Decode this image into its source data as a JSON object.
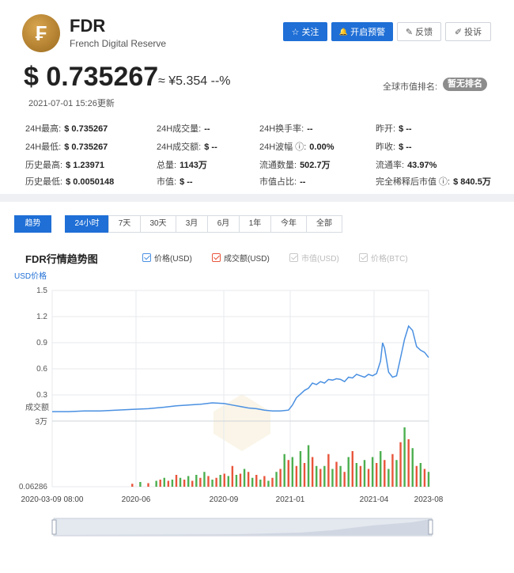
{
  "header": {
    "symbol": "FDR",
    "full_name": "French Digital Reserve",
    "logo_glyph": "₣",
    "buttons": [
      {
        "icon": "star-icon",
        "glyph": "☆",
        "label": "关注"
      },
      {
        "icon": "bell-icon",
        "glyph": "🔔",
        "label": "开启预警"
      },
      {
        "icon": "edit-icon",
        "glyph": "✎",
        "label": "反馈"
      },
      {
        "icon": "pen-icon",
        "glyph": "✐",
        "label": "投诉"
      }
    ]
  },
  "price": {
    "usd": "$ 0.735267",
    "cny": "≈ ¥5.354  --%",
    "updated": "2021-07-01 15:26更新",
    "rank_label": "全球市值排名:",
    "rank_value": "暂无排名"
  },
  "stats": [
    [
      {
        "k": "24H最高:",
        "v": "$ 0.735267"
      },
      {
        "k": "24H成交量:",
        "v": "--"
      },
      {
        "k": "24H换手率:",
        "v": "--"
      },
      {
        "k": "昨开:",
        "v": "$ --"
      }
    ],
    [
      {
        "k": "24H最低:",
        "v": "$ 0.735267"
      },
      {
        "k": "24H成交额:",
        "v": "$ --"
      },
      {
        "k": "24H波幅 ⓘ:",
        "v": "0.00%"
      },
      {
        "k": "昨收:",
        "v": "$ --"
      }
    ],
    [
      {
        "k": "历史最高:",
        "v": "$ 1.23971"
      },
      {
        "k": "总量:",
        "v": "1143万"
      },
      {
        "k": "流通数量:",
        "v": "502.7万"
      },
      {
        "k": "流通率:",
        "v": "43.97%"
      }
    ],
    [
      {
        "k": "历史最低:",
        "v": "$ 0.0050148"
      },
      {
        "k": "市值:",
        "v": "$ --"
      },
      {
        "k": "市值占比:",
        "v": "--"
      },
      {
        "k": "完全稀释后市值 ⓘ:",
        "v": "$ 840.5万"
      }
    ]
  ],
  "tabs": {
    "trend": "趋势",
    "ranges": [
      "24小时",
      "7天",
      "30天",
      "3月",
      "6月",
      "1年",
      "今年",
      "全部"
    ],
    "active": "24小时"
  },
  "chart_title": "FDR行情趋势图",
  "legend": [
    {
      "label": "价格(USD)",
      "color": "#4a90e2",
      "enabled": true
    },
    {
      "label": "成交额(USD)",
      "color": "#e8553b",
      "enabled": true
    },
    {
      "label": "市值(USD)",
      "color": "#c8c8c8",
      "enabled": false
    },
    {
      "label": "价格(BTC)",
      "color": "#c8c8c8",
      "enabled": false
    }
  ],
  "chart_data": {
    "type": "line",
    "ylabel": "USD价格",
    "volume_label": "成交额",
    "y_ticks": [
      "1.5",
      "1.2",
      "0.9",
      "0.6",
      "0.3"
    ],
    "ylim": [
      0,
      1.5
    ],
    "volume_ticks": [
      "3万",
      "0.06286"
    ],
    "x_ticks": [
      "2020-03-09 08:00",
      "2020-06",
      "2020-09",
      "2021-01",
      "2021-04",
      "2023-08"
    ],
    "price_series": {
      "name": "价格(USD)",
      "color": "#4a90e2",
      "points": [
        [
          0,
          0.01
        ],
        [
          4,
          0.01
        ],
        [
          8,
          0.02
        ],
        [
          12,
          0.02
        ],
        [
          16,
          0.03
        ],
        [
          20,
          0.04
        ],
        [
          24,
          0.05
        ],
        [
          28,
          0.07
        ],
        [
          31,
          0.09
        ],
        [
          34,
          0.1
        ],
        [
          37,
          0.11
        ],
        [
          40,
          0.13
        ],
        [
          43,
          0.12
        ],
        [
          45,
          0.1
        ],
        [
          47,
          0.08
        ],
        [
          49,
          0.06
        ],
        [
          51,
          0.05
        ],
        [
          53,
          0.03
        ],
        [
          55,
          0.02
        ],
        [
          57,
          0.02
        ],
        [
          59,
          0.03
        ],
        [
          60,
          0.1
        ],
        [
          61,
          0.2
        ],
        [
          62,
          0.25
        ],
        [
          63,
          0.3
        ],
        [
          64,
          0.33
        ],
        [
          65,
          0.4
        ],
        [
          66,
          0.38
        ],
        [
          67,
          0.42
        ],
        [
          68,
          0.4
        ],
        [
          69,
          0.45
        ],
        [
          70,
          0.44
        ],
        [
          71,
          0.46
        ],
        [
          72,
          0.45
        ],
        [
          73,
          0.42
        ],
        [
          74,
          0.48
        ],
        [
          75,
          0.47
        ],
        [
          76,
          0.52
        ],
        [
          77,
          0.5
        ],
        [
          78,
          0.48
        ],
        [
          79,
          0.52
        ],
        [
          80,
          0.5
        ],
        [
          81,
          0.53
        ],
        [
          82,
          0.7
        ],
        [
          82.5,
          0.95
        ],
        [
          83,
          0.88
        ],
        [
          84,
          0.55
        ],
        [
          85,
          0.48
        ],
        [
          86,
          0.5
        ],
        [
          87,
          0.75
        ],
        [
          88,
          1.0
        ],
        [
          89,
          1.18
        ],
        [
          90,
          1.12
        ],
        [
          91,
          0.9
        ],
        [
          92,
          0.85
        ],
        [
          93,
          0.82
        ],
        [
          94,
          0.75
        ]
      ]
    },
    "volume_series": {
      "name": "成交额(USD)",
      "colors": [
        "#e8553b",
        "#4caf50"
      ],
      "bars": [
        [
          20,
          0.05
        ],
        [
          22,
          0.08
        ],
        [
          24,
          0.06
        ],
        [
          26,
          0.1
        ],
        [
          27,
          0.12
        ],
        [
          28,
          0.15
        ],
        [
          29,
          0.1
        ],
        [
          30,
          0.12
        ],
        [
          31,
          0.2
        ],
        [
          32,
          0.15
        ],
        [
          33,
          0.12
        ],
        [
          34,
          0.18
        ],
        [
          35,
          0.1
        ],
        [
          36,
          0.2
        ],
        [
          37,
          0.15
        ],
        [
          38,
          0.25
        ],
        [
          39,
          0.18
        ],
        [
          40,
          0.12
        ],
        [
          41,
          0.15
        ],
        [
          42,
          0.2
        ],
        [
          43,
          0.22
        ],
        [
          44,
          0.18
        ],
        [
          45,
          0.35
        ],
        [
          46,
          0.2
        ],
        [
          47,
          0.22
        ],
        [
          48,
          0.3
        ],
        [
          49,
          0.25
        ],
        [
          50,
          0.15
        ],
        [
          51,
          0.2
        ],
        [
          52,
          0.12
        ],
        [
          53,
          0.18
        ],
        [
          54,
          0.1
        ],
        [
          55,
          0.15
        ],
        [
          56,
          0.25
        ],
        [
          57,
          0.3
        ],
        [
          58,
          0.55
        ],
        [
          59,
          0.45
        ],
        [
          60,
          0.5
        ],
        [
          61,
          0.35
        ],
        [
          62,
          0.6
        ],
        [
          63,
          0.4
        ],
        [
          64,
          0.7
        ],
        [
          65,
          0.5
        ],
        [
          66,
          0.35
        ],
        [
          67,
          0.3
        ],
        [
          68,
          0.35
        ],
        [
          69,
          0.55
        ],
        [
          70,
          0.3
        ],
        [
          71,
          0.42
        ],
        [
          72,
          0.35
        ],
        [
          73,
          0.25
        ],
        [
          74,
          0.5
        ],
        [
          75,
          0.6
        ],
        [
          76,
          0.4
        ],
        [
          77,
          0.35
        ],
        [
          78,
          0.45
        ],
        [
          79,
          0.3
        ],
        [
          80,
          0.5
        ],
        [
          81,
          0.4
        ],
        [
          82,
          0.6
        ],
        [
          83,
          0.45
        ],
        [
          84,
          0.3
        ],
        [
          85,
          0.55
        ],
        [
          86,
          0.45
        ],
        [
          87,
          0.75
        ],
        [
          88,
          1.0
        ],
        [
          89,
          0.8
        ],
        [
          90,
          0.65
        ],
        [
          91,
          0.35
        ],
        [
          92,
          0.4
        ],
        [
          93,
          0.3
        ],
        [
          94,
          0.25
        ]
      ]
    }
  },
  "grid_color": "#e7eaee",
  "accent_color": "#1f6fd6"
}
